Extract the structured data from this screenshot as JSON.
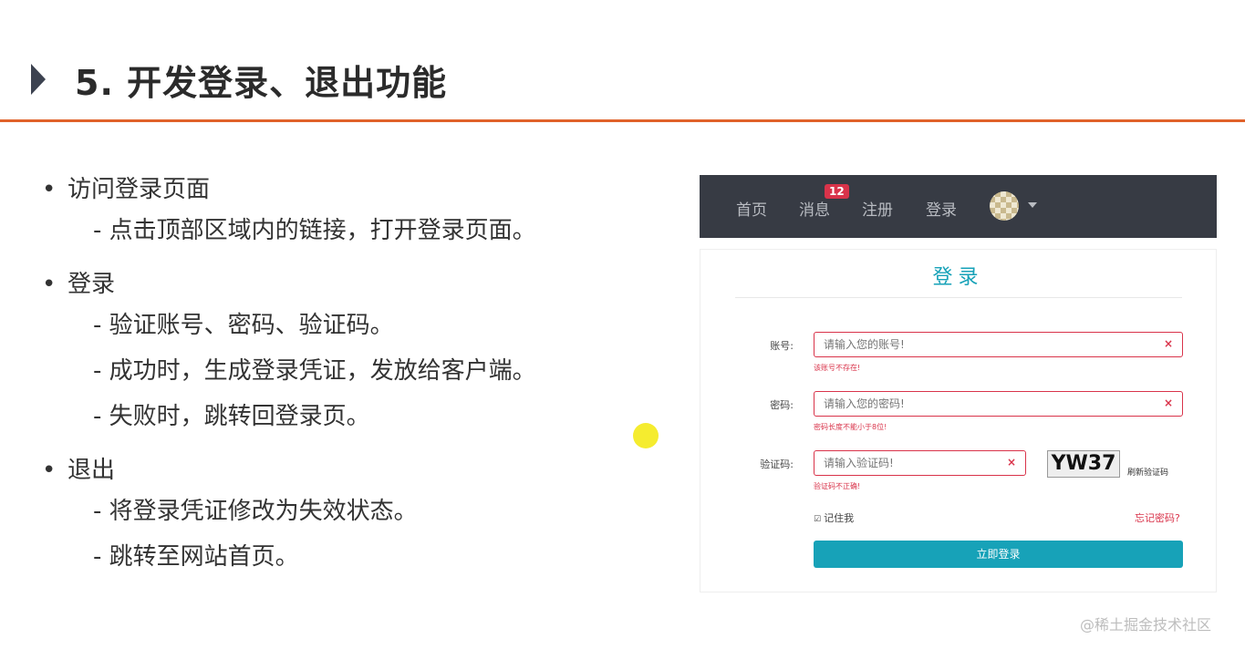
{
  "title": "5. 开发登录、退出功能",
  "bullets": [
    {
      "text": "访问登录页面",
      "subs": [
        "- 点击顶部区域内的链接，打开登录页面。"
      ]
    },
    {
      "text": "登录",
      "subs": [
        "- 验证账号、密码、验证码。",
        "- 成功时，生成登录凭证，发放给客户端。",
        "- 失败时，跳转回登录页。"
      ]
    },
    {
      "text": "退出",
      "subs": [
        "- 将登录凭证修改为失效状态。",
        "- 跳转至网站首页。"
      ]
    }
  ],
  "bullet_dot": "•",
  "app": {
    "nav": {
      "home": "首页",
      "messages": "消息",
      "badge": "12",
      "register": "注册",
      "login": "登录"
    },
    "card_title": "登录",
    "account": {
      "label": "账号:",
      "placeholder": "请输入您的账号!",
      "error": "该账号不存在!"
    },
    "password": {
      "label": "密码:",
      "placeholder": "请输入您的密码!",
      "error": "密码长度不能小于8位!"
    },
    "captcha": {
      "label": "验证码:",
      "placeholder": "请输入验证码!",
      "error": "验证码不正确!",
      "image_text": "YW37",
      "refresh": "刷新验证码"
    },
    "remember": "记住我",
    "forgot": "忘记密码?",
    "submit": "立即登录",
    "clear_glyph": "×",
    "check_glyph": "☑"
  },
  "watermark": "@稀土掘金技术社区",
  "colors": {
    "accent": "#e0622a",
    "teal": "#17a2b8",
    "error": "#d9334a",
    "nav_bg": "#373b44"
  }
}
